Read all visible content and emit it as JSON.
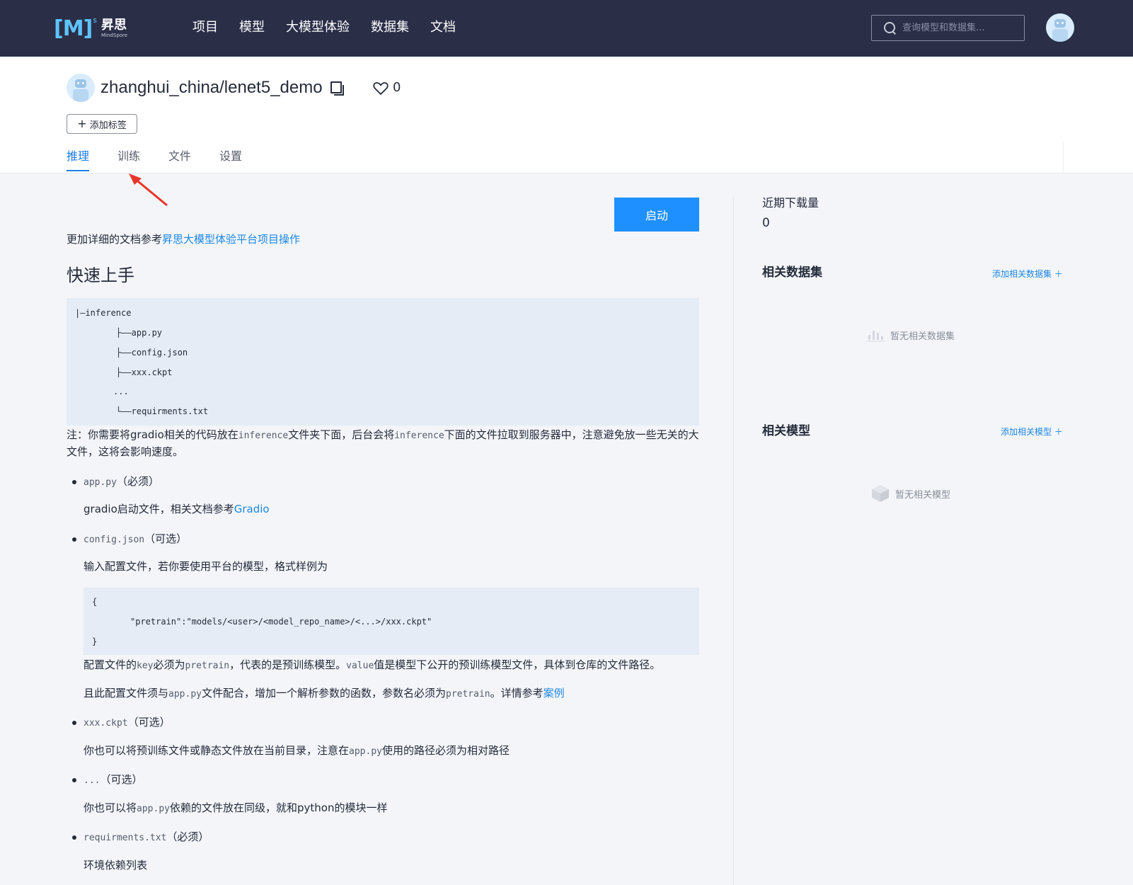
{
  "nav": {
    "logo_mark": "[M]",
    "logo_sup": "s",
    "logo_cn": "昇思",
    "logo_en": "MindSpore",
    "items": [
      "项目",
      "模型",
      "大模型体验",
      "数据集",
      "文档"
    ],
    "search_placeholder": "查询模型和数据集..."
  },
  "repo": {
    "name": "zhanghui_china/lenet5_demo",
    "likes": "0",
    "add_tag": "添加标签",
    "tabs": [
      "推理",
      "训练",
      "文件",
      "设置"
    ],
    "active_tab": "推理"
  },
  "main": {
    "start_button": "启动",
    "doc_hint_prefix": "更加详细的文档参考",
    "doc_hint_link": "昇思大模型体验平台项目操作",
    "quick_start_title": "快速上手",
    "tree_lines": [
      "|—inference",
      "├——app.py",
      "├——config.json",
      "├——xxx.ckpt",
      "...",
      "└——requirments.txt"
    ],
    "note": {
      "p1": "注：你需要将gradio相关的代码放在",
      "c1": "inference",
      "p2": "文件夹下面，后台会将",
      "c2": "inference",
      "p3": "下面的文件拉取到服务器中，注意避免放一些无关的大文件，这将会影响速度。"
    },
    "items": [
      {
        "code": "app.py",
        "tag": "（必须）"
      },
      {
        "code": "config.json",
        "tag": "（可选）"
      },
      {
        "code": "xxx.ckpt",
        "tag": "（可选）"
      },
      {
        "code": "...",
        "tag": "（可选）"
      },
      {
        "code": "requirments.txt",
        "tag": "（必须）"
      }
    ],
    "app_desc_prefix": "gradio启动文件，相关文档参考",
    "app_desc_link": "Gradio",
    "config_desc": "输入配置文件，若你要使用平台的模型，格式样例为",
    "config_lines": [
      "{",
      "\"pretrain\":\"models/<user>/<model_repo_name>/<...>/xxx.ckpt\"",
      "}"
    ],
    "config_note1": {
      "a": "配置文件的",
      "b": "key",
      "c": "必须为",
      "d": "pretrain",
      "e": "，代表的是预训练模型。",
      "f": "value",
      "g": "值是模型下公开的预训练模型文件，具体到仓库的文件路径。"
    },
    "config_note2": {
      "a": "且此配置文件须与",
      "b": "app.py",
      "c": "文件配合，增加一个解析参数的函数，参数名必须为",
      "d": "pretrain",
      "e": "。详情参考",
      "link": "案例"
    },
    "ckpt_desc": {
      "a": "你也可以将预训练文件或静态文件放在当前目录，注意在",
      "b": "app.py",
      "c": "使用的路径必须为相对路径"
    },
    "dots_desc": {
      "a": "你也可以将",
      "b": "app.py",
      "c": "依赖的文件放在同级，就和python的模块一样"
    },
    "req_desc": "环境依赖列表"
  },
  "sidebar": {
    "downloads_label": "近期下载量",
    "downloads_value": "0",
    "datasets_title": "相关数据集",
    "datasets_add": "添加相关数据集 ＋",
    "datasets_empty": "暂无相关数据集",
    "models_title": "相关模型",
    "models_add": "添加相关模型 ＋",
    "models_empty": "暂无相关模型"
  },
  "colors": {
    "accent": "#1e90ff",
    "nav_bg": "#2a2e47",
    "link": "#1e88e5"
  }
}
